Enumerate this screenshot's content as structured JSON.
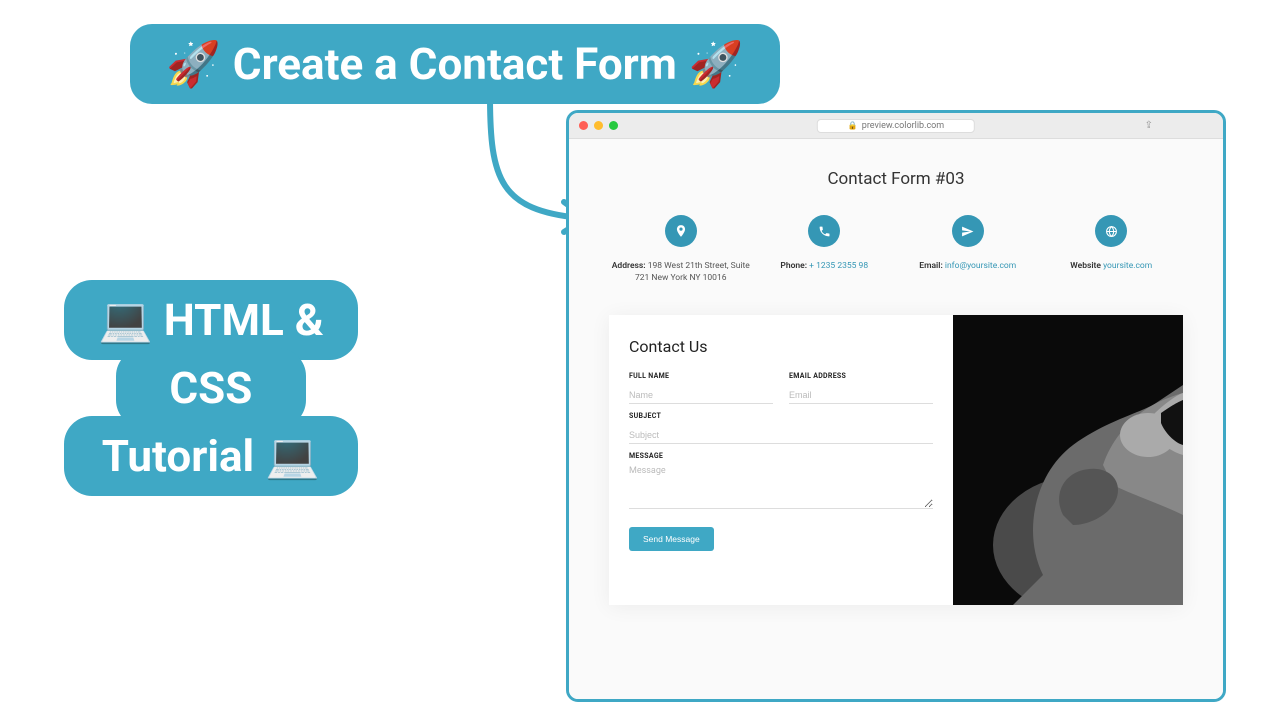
{
  "colors": {
    "accent": "#3fa8c5",
    "icon_bg": "#3597b5"
  },
  "badges": {
    "top": "Create a Contact Form",
    "left_line1": "HTML &",
    "left_line2": "CSS",
    "left_line3": "Tutorial"
  },
  "emoji": {
    "rocket": "🚀",
    "laptop": "💻"
  },
  "browser": {
    "url": "preview.colorlib.com"
  },
  "page": {
    "title": "Contact Form #03",
    "info": [
      {
        "icon": "pin-icon",
        "label": "Address:",
        "value": "198 West 21th Street, Suite 721 New York NY 10016",
        "link": false
      },
      {
        "icon": "phone-icon",
        "label": "Phone:",
        "value": "+ 1235 2355 98",
        "link": true
      },
      {
        "icon": "plane-icon",
        "label": "Email:",
        "value": "info@yoursite.com",
        "link": true
      },
      {
        "icon": "globe-icon",
        "label": "Website",
        "value": "yoursite.com",
        "link": true
      }
    ],
    "form": {
      "title": "Contact Us",
      "fields": {
        "fullname": {
          "label": "FULL NAME",
          "placeholder": "Name"
        },
        "email": {
          "label": "EMAIL ADDRESS",
          "placeholder": "Email"
        },
        "subject": {
          "label": "SUBJECT",
          "placeholder": "Subject"
        },
        "message": {
          "label": "MESSAGE",
          "placeholder": "Message"
        }
      },
      "submit": "Send Message"
    }
  }
}
